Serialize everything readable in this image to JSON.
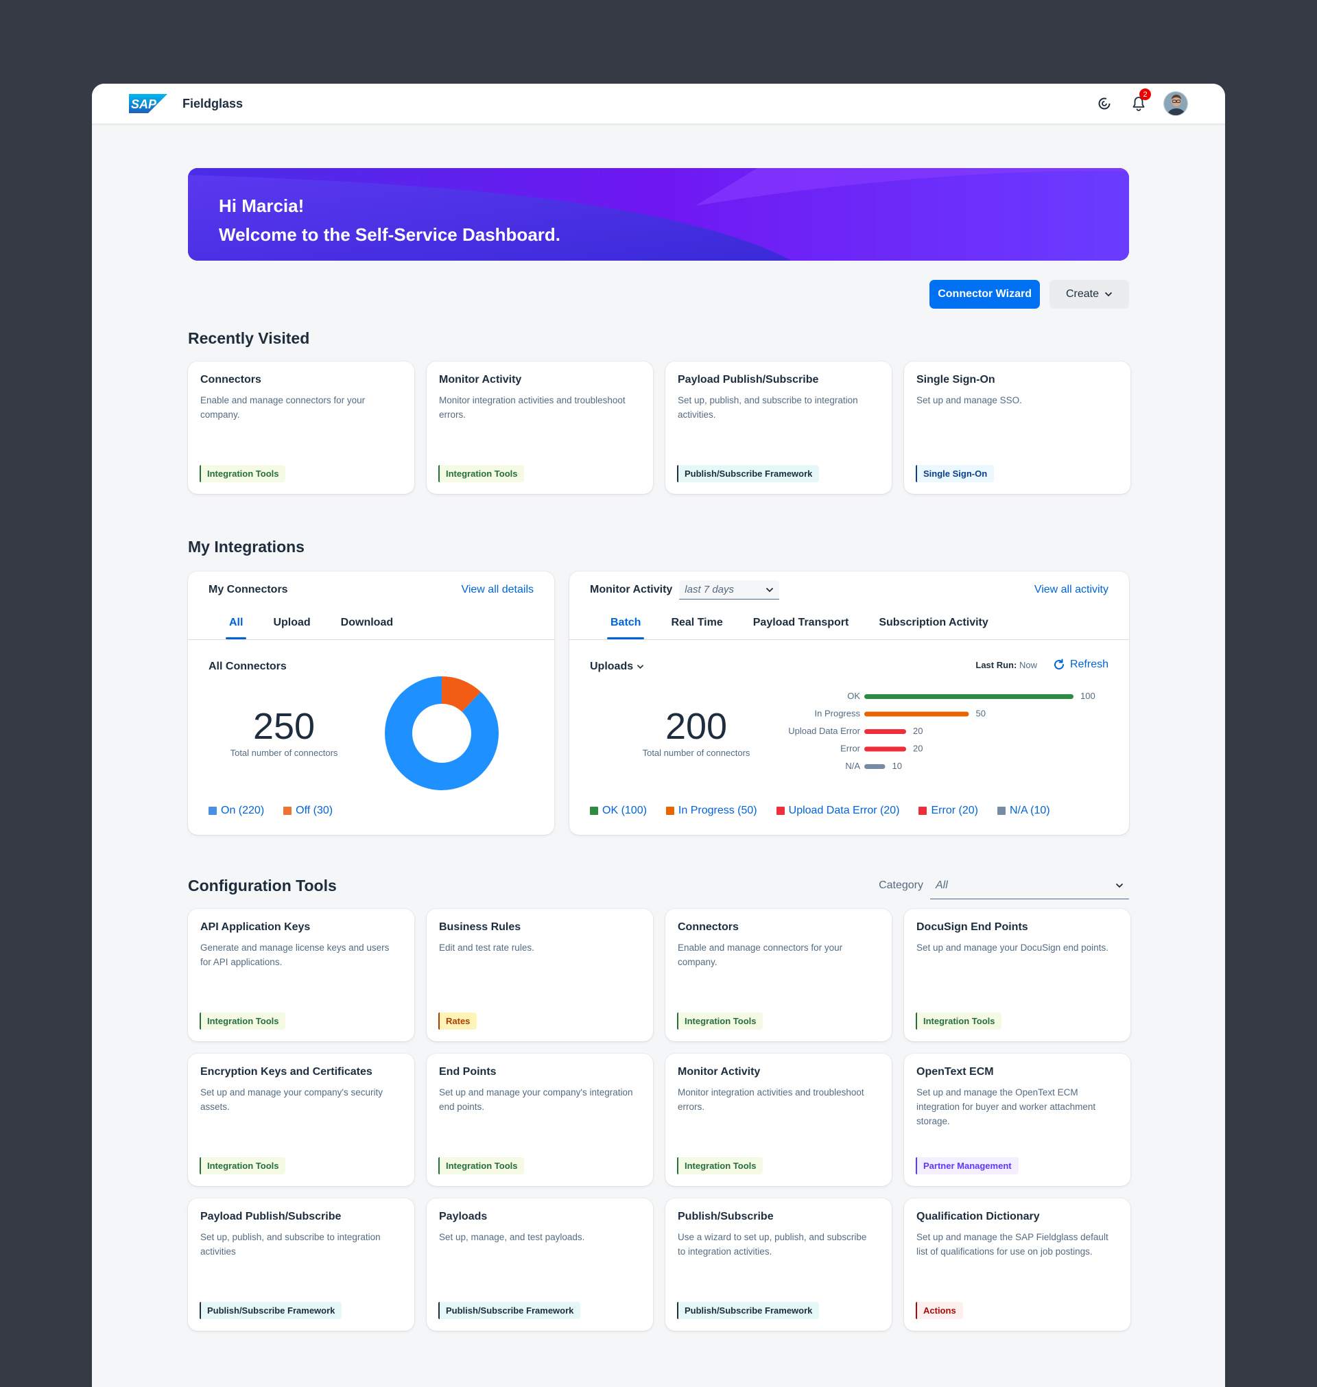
{
  "shell": {
    "app_title": "Fieldglass",
    "notification_count": "2",
    "logo_text": "SAP"
  },
  "banner": {
    "greeting": "Hi Marcia!",
    "welcome": "Welcome to the Self-Service Dashboard."
  },
  "actions": {
    "connector_wizard": "Connector Wizard",
    "create": "Create"
  },
  "recently_visited": {
    "title": "Recently Visited",
    "cards": [
      {
        "title": "Connectors",
        "desc": "Enable and manage connectors for your company.",
        "tag": "Integration Tools",
        "tag_style": "green"
      },
      {
        "title": "Monitor Activity",
        "desc": "Monitor integration activities and troubleshoot errors.",
        "tag": "Integration Tools",
        "tag_style": "green"
      },
      {
        "title": "Payload Publish/Subscribe",
        "desc": "Set up, publish, and subscribe to integration activities.",
        "tag": "Publish/Subscribe Framework",
        "tag_style": "teal"
      },
      {
        "title": "Single Sign-On",
        "desc": "Set up and manage SSO.",
        "tag": "Single Sign-On",
        "tag_style": "blue"
      }
    ]
  },
  "my_integrations": {
    "title": "My Integrations",
    "connectors": {
      "title": "My Connectors",
      "view_all": "View all details",
      "tabs": [
        "All",
        "Upload",
        "Download"
      ],
      "subtitle": "All Connectors",
      "total": "250",
      "total_label": "Total number of connectors",
      "legend": [
        {
          "label": "On (220)",
          "color": "#4a90e2"
        },
        {
          "label": "Off (30)",
          "color": "#ed7433"
        }
      ]
    },
    "monitor": {
      "title": "Monitor Activity",
      "range": "last 7 days",
      "view_all": "View all activity",
      "tabs": [
        "Batch",
        "Real Time",
        "Payload Transport",
        "Subscription Activity"
      ],
      "dropdown": "Uploads",
      "last_run_label": "Last Run:",
      "last_run_value": "Now",
      "refresh": "Refresh",
      "total": "200",
      "total_label": "Total number of connectors",
      "legend": [
        {
          "label": "OK (100)",
          "color": "#2e8b43"
        },
        {
          "label": "In Progress (50)",
          "color": "#e76500"
        },
        {
          "label": "Upload Data Error (20)",
          "color": "#ee2f3b"
        },
        {
          "label": "Error (20)",
          "color": "#ee2f3b"
        },
        {
          "label": "N/A (10)",
          "color": "#758ca4"
        }
      ]
    }
  },
  "chart_data": [
    {
      "type": "pie",
      "variant": "donut",
      "categories": [
        "On",
        "Off"
      ],
      "values": [
        220,
        30
      ],
      "colors": [
        "#1e90ff",
        "#f15d14"
      ]
    },
    {
      "type": "bar",
      "orientation": "horizontal",
      "categories": [
        "OK",
        "In Progress",
        "Upload Data Error",
        "Error",
        "N/A"
      ],
      "values": [
        100,
        50,
        20,
        20,
        10
      ],
      "colors": [
        "#2e8b43",
        "#e76500",
        "#ee2f3b",
        "#ee2f3b",
        "#758ca4"
      ],
      "xlim": [
        0,
        100
      ]
    }
  ],
  "config_tools": {
    "title": "Configuration Tools",
    "category_label": "Category",
    "category_value": "All",
    "cards": [
      {
        "title": "API Application Keys",
        "desc": "Generate and manage license keys and users for API applications.",
        "tag": "Integration Tools",
        "tag_style": "green"
      },
      {
        "title": "Business Rules",
        "desc": "Edit and test rate rules.",
        "tag": "Rates",
        "tag_style": "orange"
      },
      {
        "title": "Connectors",
        "desc": "Enable and manage connectors for your company.",
        "tag": "Integration Tools",
        "tag_style": "green"
      },
      {
        "title": "DocuSign End Points",
        "desc": "Set up and manage your DocuSign end points.",
        "tag": "Integration Tools",
        "tag_style": "green"
      },
      {
        "title": "Encryption Keys and Certificates",
        "desc": "Set up and manage your company's security assets.",
        "tag": "Integration Tools",
        "tag_style": "green"
      },
      {
        "title": "End Points",
        "desc": "Set up and manage your company's integration end points.",
        "tag": "Integration Tools",
        "tag_style": "green"
      },
      {
        "title": "Monitor Activity",
        "desc": "Monitor integration activities and troubleshoot errors.",
        "tag": "Integration Tools",
        "tag_style": "green"
      },
      {
        "title": "OpenText ECM",
        "desc": "Set up and manage the OpenText ECM integration for buyer and worker attachment storage.",
        "tag": "Partner Management",
        "tag_style": "purple"
      },
      {
        "title": "Payload Publish/Subscribe",
        "desc": "Set up, publish, and subscribe to integration activities",
        "tag": "Publish/Subscribe Framework",
        "tag_style": "teal"
      },
      {
        "title": "Payloads",
        "desc": "Set up, manage, and test payloads.",
        "tag": "Publish/Subscribe Framework",
        "tag_style": "teal"
      },
      {
        "title": "Publish/Subscribe",
        "desc": "Use a wizard to set up, publish, and subscribe to integration activities.",
        "tag": "Publish/Subscribe Framework",
        "tag_style": "teal"
      },
      {
        "title": "Qualification Dictionary",
        "desc": "Set up and manage the SAP Fieldglass default list of qualifications for use on job postings.",
        "tag": "Actions",
        "tag_style": "red"
      }
    ]
  }
}
